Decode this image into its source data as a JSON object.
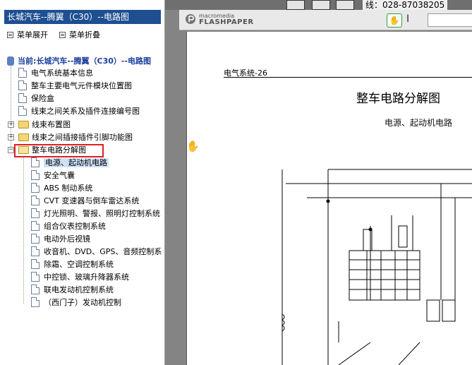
{
  "left_pane": {
    "title": "长城汽车--腾翼（C30）--电路图",
    "menu": {
      "expand_label": "菜单展开",
      "collapse_label": "菜单折叠"
    },
    "root_label": "当前:长城汽车--腾翼（C30）--电路图",
    "items": [
      {
        "label": "电气系统基本信息",
        "type": "doc"
      },
      {
        "label": "整车主要电气元件模块位置图",
        "type": "doc"
      },
      {
        "label": "保险盒",
        "type": "doc"
      },
      {
        "label": "线束之间关系及插件连接编号图",
        "type": "doc"
      },
      {
        "label": "线束布置图",
        "type": "folder"
      },
      {
        "label": "线束之间插接插件引脚功能图",
        "type": "folder"
      },
      {
        "label": "整车电路分解图",
        "type": "folder-open"
      }
    ],
    "subitems": [
      {
        "label": "电源、起动机电路"
      },
      {
        "label": "安全气囊"
      },
      {
        "label": "ABS 制动系统"
      },
      {
        "label": "CVT 变速器与倒车雷达系统"
      },
      {
        "label": "灯光照明、警报、照明灯控制系统"
      },
      {
        "label": "组合仪表控制系统"
      },
      {
        "label": "电动外后视镜"
      },
      {
        "label": "收音机、DVD、GPS、音频控制系"
      },
      {
        "label": "除霜、空调控制系统"
      },
      {
        "label": "中控锁、玻璃升降器系统"
      },
      {
        "label": "联电发动机控制系统"
      },
      {
        "label": "（西门子）发动机控制"
      }
    ],
    "expand_plus": "+",
    "expand_minus": "−"
  },
  "viewer": {
    "brand_top": "macromedia",
    "brand_bottom": "FLASHPAPER",
    "hand_tool": "✋",
    "text_tool": "I",
    "phone_text": "线：028-87038205",
    "page": {
      "section_header": "电气系统-26",
      "main_title": "整车电路分解图",
      "subtitle": "电源、起动机电路"
    }
  },
  "colors": {
    "title_bar": "#1d4f91",
    "selected_bg": "#cde0f7",
    "highlight_box": "#e02020",
    "viewer_bg": "#848484"
  }
}
